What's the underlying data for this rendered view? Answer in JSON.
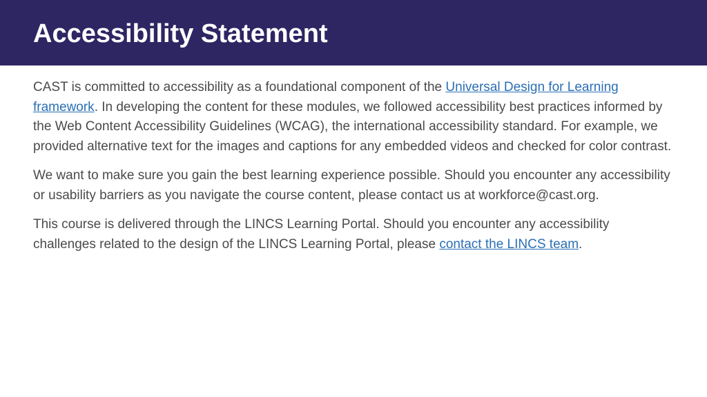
{
  "header": {
    "title": "Accessibility Statement"
  },
  "content": {
    "p1_pre": "CAST is committed to accessibility as a foundational component of the ",
    "p1_link": "Universal Design for Learning  framework",
    "p1_post": ". In developing the content for these modules, we followed accessibility best practices informed by the Web Content Accessibility Guidelines (WCAG), the international accessibility standard. For example, we provided alternative text for the images and captions for any embedded videos and checked for color contrast.",
    "p2": "We want to make sure you gain the best learning experience possible. Should you encounter any accessibility or usability barriers as you navigate the course content, please contact us at workforce@cast.org.",
    "p3_pre": "This course is delivered through the LINCS Learning Portal. Should you encounter any accessibility challenges related to the design of the LINCS Learning Portal, please ",
    "p3_link": "contact the LINCS team",
    "p3_post": "."
  }
}
